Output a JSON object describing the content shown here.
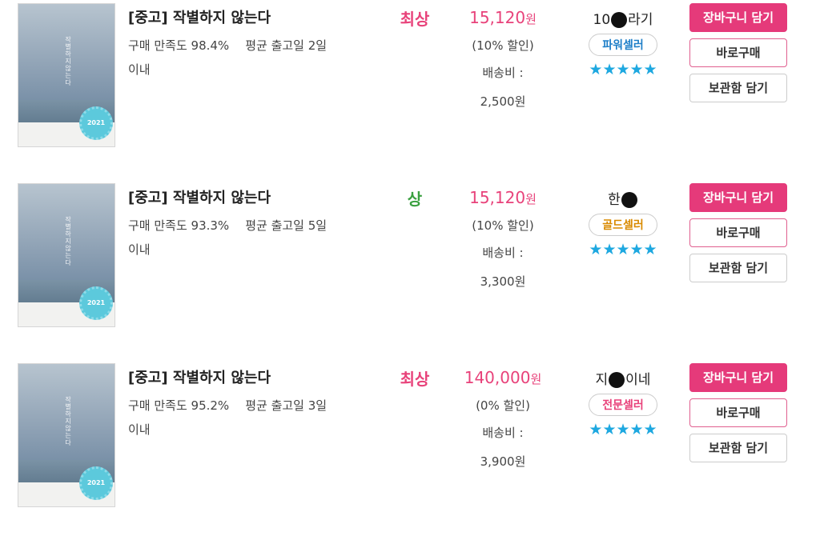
{
  "colors": {
    "accent": "#e53a7a",
    "condition_best": "#e8427a",
    "condition_good": "#3aa040",
    "stars": "#1ea8e0"
  },
  "cover": {
    "badge_text": "2021",
    "spine_text": "작별하지 않는다"
  },
  "listings": [
    {
      "title": "[중고] 작별하지 않는다",
      "satisfaction": "구매 만족도 98.4%",
      "ship_days": "평균 출고일 2일",
      "ship_days_tail": "이내",
      "condition": "최상",
      "price": "15,120",
      "won": "원",
      "discount": "(10% 할인)",
      "shipping_label": "배송비 :",
      "shipping_fee": "2,500원",
      "seller_name_prefix": "10",
      "seller_name_suffix": "라기",
      "seller_grade": "파워셀러",
      "seller_grade_color": "#1f7fc8",
      "stars": "★★★★★",
      "buttons": {
        "cart": "장바구니 담기",
        "buy": "바로구매",
        "save": "보관함 담기"
      }
    },
    {
      "title": "[중고] 작별하지 않는다",
      "satisfaction": "구매 만족도 93.3%",
      "ship_days": "평균 출고일 5일",
      "ship_days_tail": "이내",
      "condition": "상",
      "price": "15,120",
      "won": "원",
      "discount": "(10% 할인)",
      "shipping_label": "배송비 :",
      "shipping_fee": "3,300원",
      "seller_name_prefix": "한",
      "seller_name_suffix": "",
      "seller_grade": "골드셀러",
      "seller_grade_color": "#d98a00",
      "stars": "★★★★★",
      "buttons": {
        "cart": "장바구니 담기",
        "buy": "바로구매",
        "save": "보관함 담기"
      }
    },
    {
      "title": "[중고] 작별하지 않는다",
      "satisfaction": "구매 만족도 95.2%",
      "ship_days": "평균 출고일 3일",
      "ship_days_tail": "이내",
      "condition": "최상",
      "price": "140,000",
      "won": "원",
      "discount": "(0% 할인)",
      "shipping_label": "배송비 :",
      "shipping_fee": "3,900원",
      "seller_name_prefix": "지",
      "seller_name_suffix": "이네",
      "seller_grade": "전문셀러",
      "seller_grade_color": "#e8427a",
      "stars": "★★★★★",
      "buttons": {
        "cart": "장바구니 담기",
        "buy": "바로구매",
        "save": "보관함 담기"
      }
    }
  ]
}
